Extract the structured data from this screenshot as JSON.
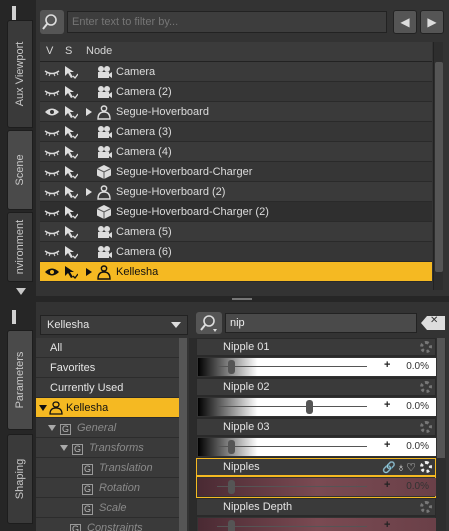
{
  "tabs": {
    "aux_viewport": "Aux Viewport",
    "scene": "Scene",
    "environment": "nvironment",
    "parameters": "Parameters",
    "shaping": "Shaping"
  },
  "scene": {
    "filter_placeholder": "Enter text to filter by...",
    "col_v": "V",
    "col_s": "S",
    "col_node": "Node",
    "rows": [
      {
        "label": "Camera",
        "icon": "camera-icon",
        "eye": "closed",
        "expand": false,
        "selected": false
      },
      {
        "label": "Camera (2)",
        "icon": "camera-icon",
        "eye": "closed",
        "expand": false,
        "selected": false
      },
      {
        "label": "Segue-Hoverboard",
        "icon": "figure-icon",
        "eye": "open",
        "expand": true,
        "selected": false
      },
      {
        "label": "Camera (3)",
        "icon": "camera-icon",
        "eye": "closed",
        "expand": false,
        "selected": false
      },
      {
        "label": "Camera (4)",
        "icon": "camera-icon",
        "eye": "closed",
        "expand": false,
        "selected": false
      },
      {
        "label": "Segue-Hoverboard-Charger",
        "icon": "prop-icon",
        "eye": "closed",
        "expand": false,
        "selected": false
      },
      {
        "label": "Segue-Hoverboard (2)",
        "icon": "figure-icon",
        "eye": "closed",
        "expand": true,
        "selected": false
      },
      {
        "label": "Segue-Hoverboard-Charger (2)",
        "icon": "prop-icon",
        "eye": "closed",
        "expand": false,
        "selected": false
      },
      {
        "label": "Camera (5)",
        "icon": "camera-icon",
        "eye": "closed",
        "expand": false,
        "selected": false
      },
      {
        "label": "Camera (6)",
        "icon": "camera-icon",
        "eye": "closed",
        "expand": false,
        "selected": false
      },
      {
        "label": "Kellesha",
        "icon": "figure-icon",
        "eye": "open",
        "expand": true,
        "selected": true
      }
    ]
  },
  "params": {
    "node_selected": "Kellesha",
    "list": {
      "all": "All",
      "favorites": "Favorites",
      "currently_used": "Currently Used",
      "kellesha": "Kellesha",
      "general": "General",
      "transforms": "Transforms",
      "translation": "Translation",
      "rotation": "Rotation",
      "scale": "Scale",
      "constraints": "Constraints"
    },
    "search_value": "nip",
    "sliders": [
      {
        "label": "Nipple 01",
        "value": "0.0%",
        "style": "gray",
        "active": false
      },
      {
        "label": "Nipple 02",
        "value": "0.0%",
        "style": "gray",
        "active": false
      },
      {
        "label": "Nipple 03",
        "value": "0.0%",
        "style": "gray",
        "active": false
      },
      {
        "label": "Nipples",
        "value": "0.0%",
        "style": "red",
        "active": true
      },
      {
        "label": "Nipples Depth",
        "value": "",
        "style": "red",
        "active": false
      }
    ],
    "slider_knob_fraction": [
      0.06,
      0.47,
      0.06,
      0.06,
      0.06
    ]
  },
  "colors": {
    "accent": "#f5b922",
    "panel": "#333333"
  }
}
